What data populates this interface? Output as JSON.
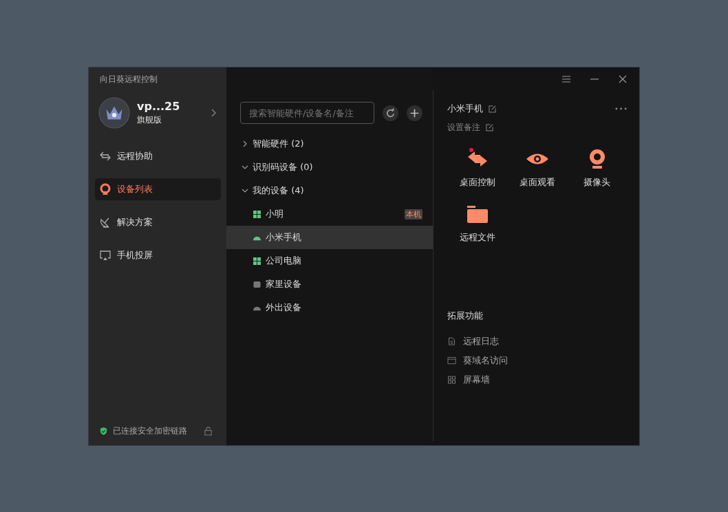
{
  "window": {
    "title": "向日葵远程控制"
  },
  "user": {
    "name": "vp...25",
    "plan": "旗舰版"
  },
  "nav": [
    {
      "label": "远程协助",
      "kind": "assist",
      "selected": false
    },
    {
      "label": "设备列表",
      "kind": "devices",
      "selected": true
    },
    {
      "label": "解决方案",
      "kind": "solutions",
      "selected": false
    },
    {
      "label": "手机投屏",
      "kind": "cast",
      "selected": false
    }
  ],
  "status_bar": {
    "text": "已连接安全加密链路"
  },
  "search": {
    "placeholder": "搜索智能硬件/设备名/备注"
  },
  "groups": [
    {
      "label": "智能硬件 (2)",
      "expanded": false
    },
    {
      "label": "识别码设备 (0)",
      "expanded": true
    },
    {
      "label": "我的设备 (4)",
      "expanded": true,
      "children": [
        {
          "name": "小明",
          "kind": "windows",
          "online": true,
          "selected": false,
          "badge": "本机"
        },
        {
          "name": "小米手机",
          "kind": "android",
          "online": true,
          "selected": true
        },
        {
          "name": "公司电脑",
          "kind": "windows",
          "online": true,
          "selected": false
        },
        {
          "name": "家里设备",
          "kind": "box",
          "online": false,
          "selected": false
        },
        {
          "name": "外出设备",
          "kind": "android",
          "online": false,
          "selected": false
        }
      ]
    }
  ],
  "detail": {
    "name": "小米手机",
    "note": "设置备注",
    "actions": [
      {
        "label": "桌面控制",
        "kind": "control",
        "alert": true
      },
      {
        "label": "桌面观看",
        "kind": "view",
        "alert": false
      },
      {
        "label": "摄像头",
        "kind": "camera",
        "alert": false
      },
      {
        "label": "远程文件",
        "kind": "files",
        "alert": false
      }
    ],
    "extensions_title": "拓展功能",
    "extensions": [
      {
        "label": "远程日志",
        "kind": "log"
      },
      {
        "label": "葵域名访问",
        "kind": "domain"
      },
      {
        "label": "屏幕墙",
        "kind": "wall"
      }
    ]
  }
}
